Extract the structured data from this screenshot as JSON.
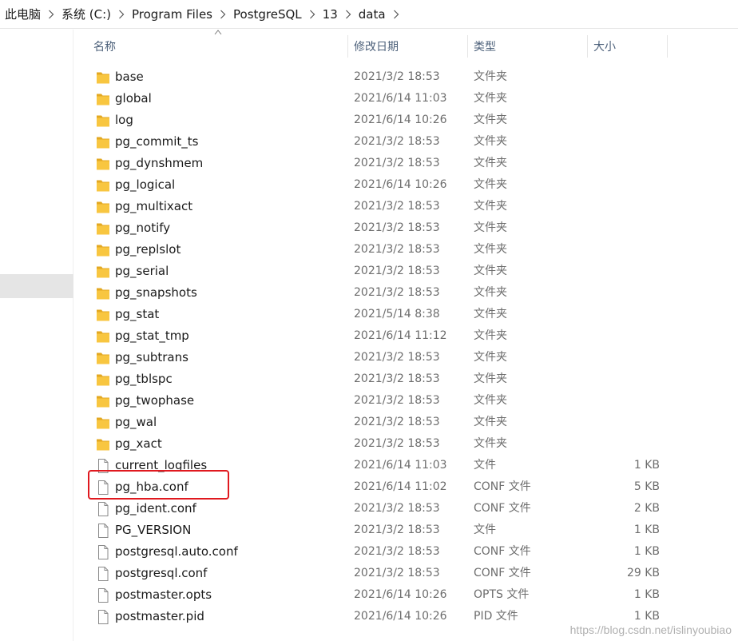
{
  "breadcrumb": [
    "此电脑",
    "系统 (C:)",
    "Program Files",
    "PostgreSQL",
    "13",
    "data"
  ],
  "columns": {
    "name": "名称",
    "date": "修改日期",
    "type": "类型",
    "size": "大小"
  },
  "files": [
    {
      "name": "base",
      "date": "2021/3/2 18:53",
      "type": "文件夹",
      "size": "",
      "kind": "folder"
    },
    {
      "name": "global",
      "date": "2021/6/14 11:03",
      "type": "文件夹",
      "size": "",
      "kind": "folder"
    },
    {
      "name": "log",
      "date": "2021/6/14 10:26",
      "type": "文件夹",
      "size": "",
      "kind": "folder"
    },
    {
      "name": "pg_commit_ts",
      "date": "2021/3/2 18:53",
      "type": "文件夹",
      "size": "",
      "kind": "folder"
    },
    {
      "name": "pg_dynshmem",
      "date": "2021/3/2 18:53",
      "type": "文件夹",
      "size": "",
      "kind": "folder"
    },
    {
      "name": "pg_logical",
      "date": "2021/6/14 10:26",
      "type": "文件夹",
      "size": "",
      "kind": "folder"
    },
    {
      "name": "pg_multixact",
      "date": "2021/3/2 18:53",
      "type": "文件夹",
      "size": "",
      "kind": "folder"
    },
    {
      "name": "pg_notify",
      "date": "2021/3/2 18:53",
      "type": "文件夹",
      "size": "",
      "kind": "folder"
    },
    {
      "name": "pg_replslot",
      "date": "2021/3/2 18:53",
      "type": "文件夹",
      "size": "",
      "kind": "folder"
    },
    {
      "name": "pg_serial",
      "date": "2021/3/2 18:53",
      "type": "文件夹",
      "size": "",
      "kind": "folder"
    },
    {
      "name": "pg_snapshots",
      "date": "2021/3/2 18:53",
      "type": "文件夹",
      "size": "",
      "kind": "folder"
    },
    {
      "name": "pg_stat",
      "date": "2021/5/14 8:38",
      "type": "文件夹",
      "size": "",
      "kind": "folder"
    },
    {
      "name": "pg_stat_tmp",
      "date": "2021/6/14 11:12",
      "type": "文件夹",
      "size": "",
      "kind": "folder"
    },
    {
      "name": "pg_subtrans",
      "date": "2021/3/2 18:53",
      "type": "文件夹",
      "size": "",
      "kind": "folder"
    },
    {
      "name": "pg_tblspc",
      "date": "2021/3/2 18:53",
      "type": "文件夹",
      "size": "",
      "kind": "folder"
    },
    {
      "name": "pg_twophase",
      "date": "2021/3/2 18:53",
      "type": "文件夹",
      "size": "",
      "kind": "folder"
    },
    {
      "name": "pg_wal",
      "date": "2021/3/2 18:53",
      "type": "文件夹",
      "size": "",
      "kind": "folder"
    },
    {
      "name": "pg_xact",
      "date": "2021/3/2 18:53",
      "type": "文件夹",
      "size": "",
      "kind": "folder"
    },
    {
      "name": "current_logfiles",
      "date": "2021/6/14 11:03",
      "type": "文件",
      "size": "1 KB",
      "kind": "file"
    },
    {
      "name": "pg_hba.conf",
      "date": "2021/6/14 11:02",
      "type": "CONF 文件",
      "size": "5 KB",
      "kind": "file"
    },
    {
      "name": "pg_ident.conf",
      "date": "2021/3/2 18:53",
      "type": "CONF 文件",
      "size": "2 KB",
      "kind": "file"
    },
    {
      "name": "PG_VERSION",
      "date": "2021/3/2 18:53",
      "type": "文件",
      "size": "1 KB",
      "kind": "file"
    },
    {
      "name": "postgresql.auto.conf",
      "date": "2021/3/2 18:53",
      "type": "CONF 文件",
      "size": "1 KB",
      "kind": "file"
    },
    {
      "name": "postgresql.conf",
      "date": "2021/3/2 18:53",
      "type": "CONF 文件",
      "size": "29 KB",
      "kind": "file"
    },
    {
      "name": "postmaster.opts",
      "date": "2021/6/14 10:26",
      "type": "OPTS 文件",
      "size": "1 KB",
      "kind": "file"
    },
    {
      "name": "postmaster.pid",
      "date": "2021/6/14 10:26",
      "type": "PID 文件",
      "size": "1 KB",
      "kind": "file"
    }
  ],
  "watermark": "https://blog.csdn.net/islinyoubiao",
  "colors": {
    "folder": "#f8c640",
    "folder_dark": "#e3a822",
    "highlight": "#e0191f",
    "header_text": "#4c607a"
  }
}
